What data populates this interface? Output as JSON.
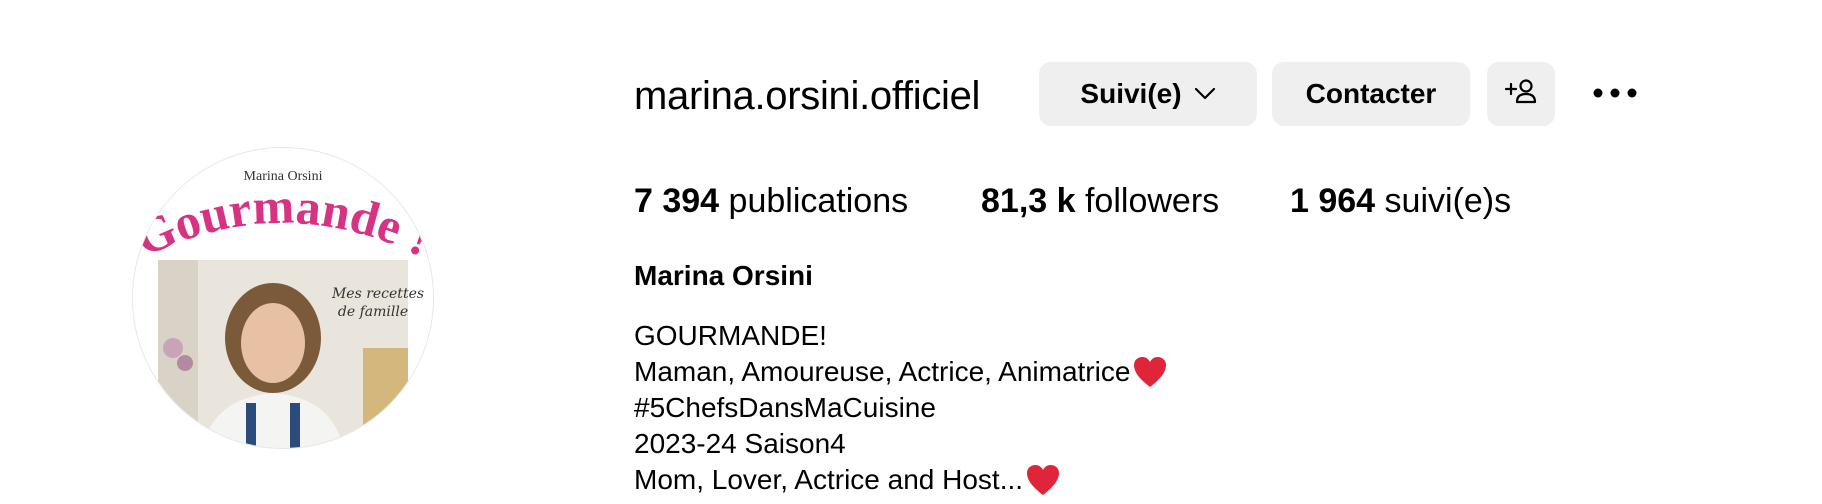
{
  "profile": {
    "username": "marina.orsini.officiel",
    "full_name": "Marina Orsini",
    "avatar": {
      "top_text": "Marina Orsini",
      "title_text": "Gourmande !",
      "script_text_1": "Mes recettes",
      "script_text_2": "de famille",
      "title_color": "#d63384"
    }
  },
  "actions": {
    "follow_label": "Suivi(e)",
    "contact_label": "Contacter",
    "suggest_icon": "add-person-icon",
    "more_icon": "more-options-icon"
  },
  "stats": {
    "posts_count": "7 394",
    "posts_label": "publications",
    "followers_count": "81,3 k",
    "followers_label": "followers",
    "following_count": "1 964",
    "following_label": "suivi(e)s"
  },
  "bio": {
    "line1": "GOURMANDE!",
    "line2": "Maman, Amoureuse, Actrice, Animatrice",
    "line3": "#5ChefsDansMaCuisine",
    "line4": "2023-24 Saison4",
    "line5": "Mom, Lover, Actrice and Host...",
    "heart_icon": "red-heart-icon",
    "heart_color": "#e0243a"
  }
}
